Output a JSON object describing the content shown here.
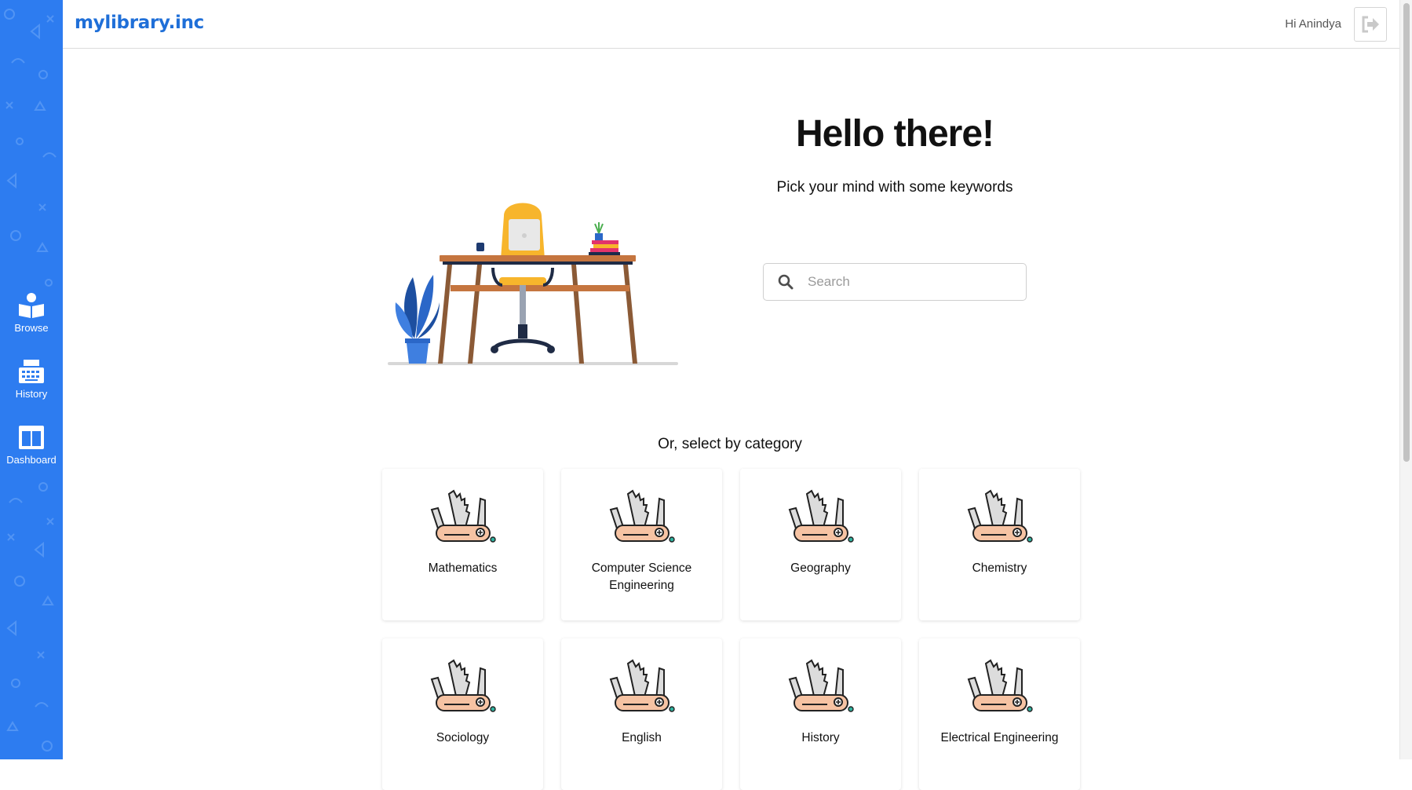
{
  "app": {
    "brand": "mylibrary.inc"
  },
  "header": {
    "greeting": "Hi Anindya",
    "logout_icon": "sign-out-icon"
  },
  "sidebar": {
    "items": [
      {
        "label": "Browse",
        "icon": "open-book-icon"
      },
      {
        "label": "History",
        "icon": "typewriter-icon"
      },
      {
        "label": "Dashboard",
        "icon": "dashboard-columns-icon"
      }
    ]
  },
  "hero": {
    "title": "Hello there!",
    "subtitle": "Pick your mind with some keywords",
    "search_placeholder": "Search"
  },
  "categories": {
    "title": "Or, select by category",
    "items": [
      {
        "label": "Mathematics"
      },
      {
        "label": "Computer Science Engineering"
      },
      {
        "label": "Geography"
      },
      {
        "label": "Chemistry"
      },
      {
        "label": "Sociology"
      },
      {
        "label": "English"
      },
      {
        "label": "History"
      },
      {
        "label": "Electrical Engineering"
      }
    ]
  },
  "colors": {
    "accent": "#2d7cf0",
    "brand": "#1f6fd8"
  }
}
